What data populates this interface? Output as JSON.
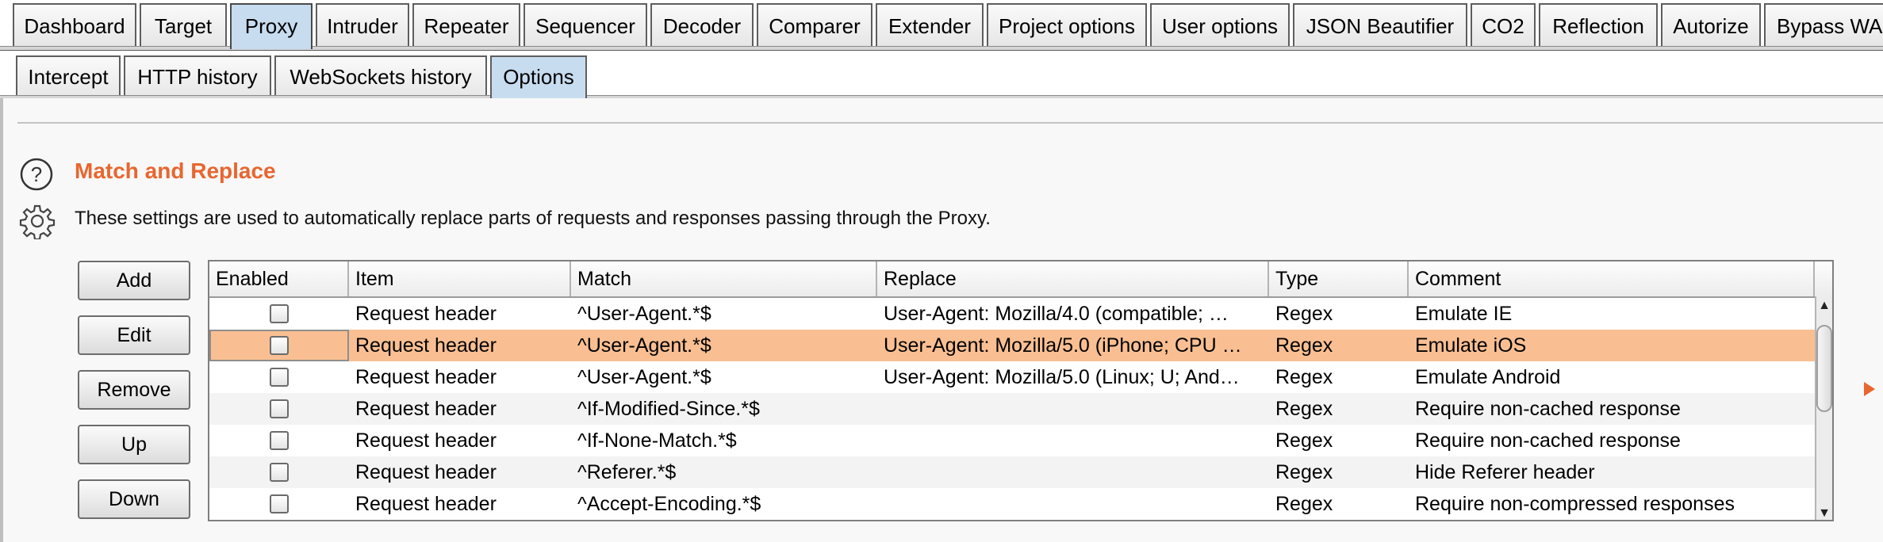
{
  "main_tabs": [
    {
      "label": "Dashboard"
    },
    {
      "label": "Target"
    },
    {
      "label": "Proxy",
      "active": true
    },
    {
      "label": "Intruder"
    },
    {
      "label": "Repeater"
    },
    {
      "label": "Sequencer"
    },
    {
      "label": "Decoder"
    },
    {
      "label": "Comparer"
    },
    {
      "label": "Extender"
    },
    {
      "label": "Project options"
    },
    {
      "label": "User options"
    },
    {
      "label": "JSON Beautifier"
    },
    {
      "label": "CO2"
    },
    {
      "label": "Reflection"
    },
    {
      "label": "Autorize"
    },
    {
      "label": "Bypass WA"
    }
  ],
  "sub_tabs": [
    {
      "label": "Intercept"
    },
    {
      "label": "HTTP history"
    },
    {
      "label": "WebSockets history"
    },
    {
      "label": "Options",
      "active": true
    }
  ],
  "section": {
    "title": "Match and Replace",
    "description": "These settings are used to automatically replace parts of requests and responses passing through the Proxy.",
    "help_icon": "question-circle-icon",
    "settings_icon": "gear-icon",
    "accent_color": "#e8662f"
  },
  "buttons": {
    "add": "Add",
    "edit": "Edit",
    "remove": "Remove",
    "up": "Up",
    "down": "Down"
  },
  "table": {
    "columns": [
      "Enabled",
      "Item",
      "Match",
      "Replace",
      "Type",
      "Comment"
    ],
    "rows": [
      {
        "enabled": false,
        "item": "Request header",
        "match": "^User-Agent.*$",
        "replace": "User-Agent: Mozilla/4.0 (compatible; …",
        "type": "Regex",
        "comment": "Emulate IE"
      },
      {
        "enabled": false,
        "item": "Request header",
        "match": "^User-Agent.*$",
        "replace": "User-Agent: Mozilla/5.0 (iPhone; CPU …",
        "type": "Regex",
        "comment": "Emulate iOS",
        "selected": true
      },
      {
        "enabled": false,
        "item": "Request header",
        "match": "^User-Agent.*$",
        "replace": "User-Agent: Mozilla/5.0 (Linux; U; And…",
        "type": "Regex",
        "comment": "Emulate Android"
      },
      {
        "enabled": false,
        "item": "Request header",
        "match": "^If-Modified-Since.*$",
        "replace": "",
        "type": "Regex",
        "comment": "Require non-cached response"
      },
      {
        "enabled": false,
        "item": "Request header",
        "match": "^If-None-Match.*$",
        "replace": "",
        "type": "Regex",
        "comment": "Require non-cached response"
      },
      {
        "enabled": false,
        "item": "Request header",
        "match": "^Referer.*$",
        "replace": "",
        "type": "Regex",
        "comment": "Hide Referer header"
      },
      {
        "enabled": false,
        "item": "Request header",
        "match": "^Accept-Encoding.*$",
        "replace": "",
        "type": "Regex",
        "comment": "Require non-compressed responses"
      }
    ],
    "selected_row_color": "#f9bf92"
  }
}
